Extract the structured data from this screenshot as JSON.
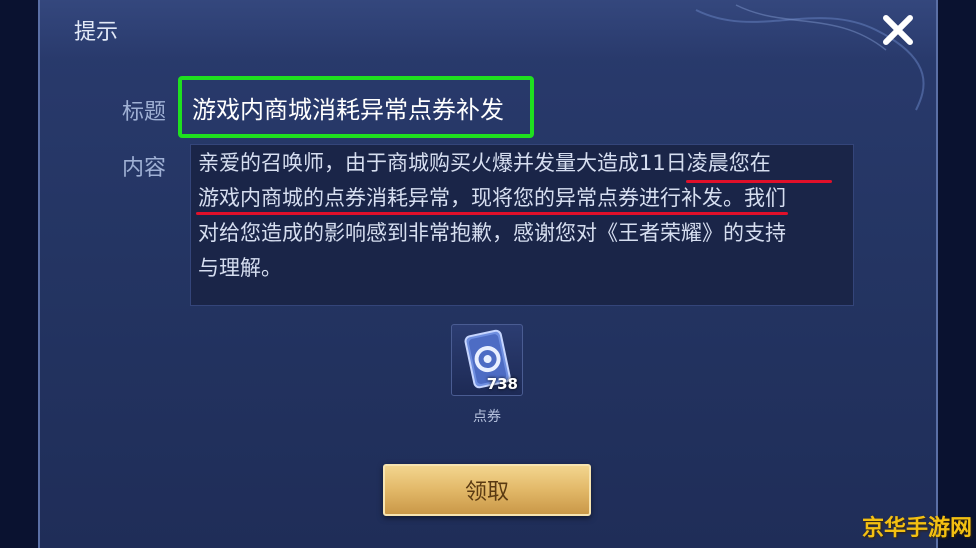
{
  "dialog": {
    "title": "提示",
    "subject_label": "标题",
    "subject": "游戏内商城消耗异常点券补发",
    "content_label": "内容",
    "content_lines": [
      "亲爱的召唤师，由于商城购买火爆并发量大造成11日凌晨您在",
      "游戏内商城的点券消耗异常，现将您的异常点券进行补发。我们",
      "对给您造成的影响感到非常抱歉，感谢您对《王者荣耀》的支持",
      "与理解。"
    ],
    "reward": {
      "name": "点券",
      "count": "738",
      "icon": "coupon-card-icon"
    },
    "claim_label": "领取",
    "close_icon": "close-icon"
  },
  "watermark": "京华手游网",
  "colors": {
    "highlight_box": "#1fe01f",
    "underline": "#e0102a",
    "button": "#e2b868"
  }
}
